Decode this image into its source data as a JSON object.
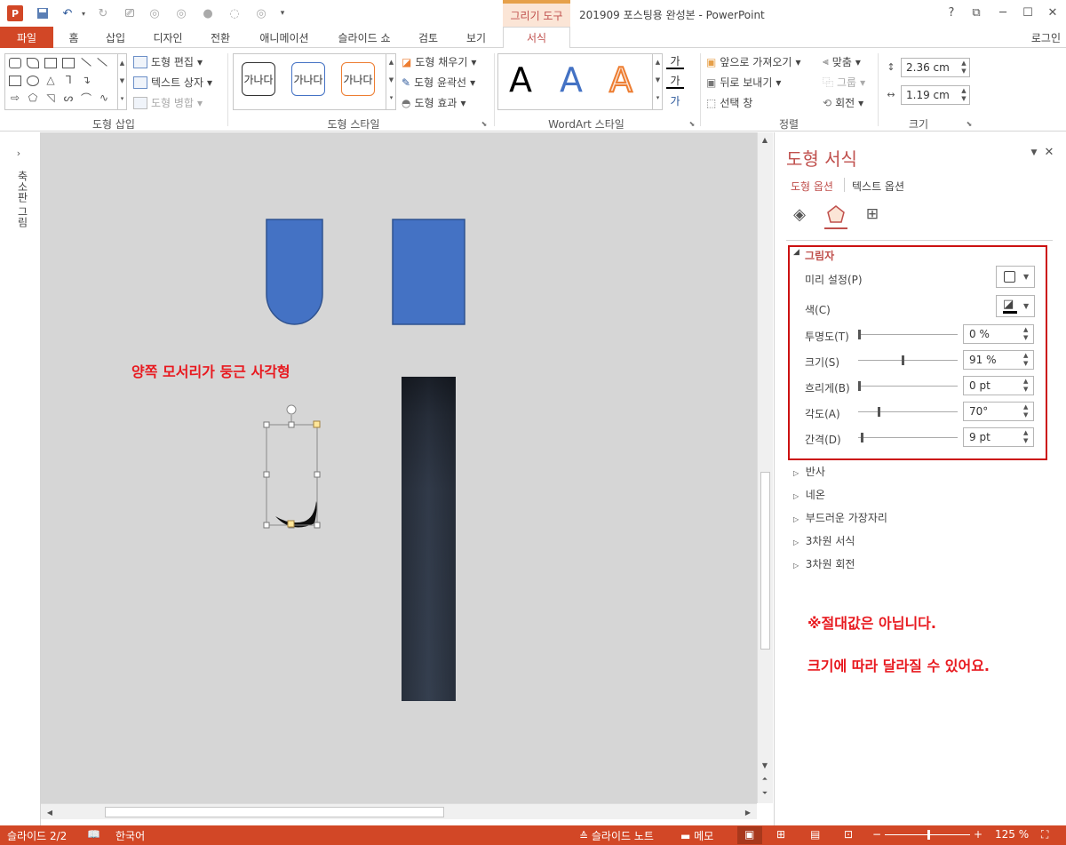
{
  "window": {
    "title": "201909 포스팅용 완성본 - PowerPoint",
    "context_tab_group": "그리기 도구",
    "login": "로그인"
  },
  "tabs": [
    {
      "label": "파일"
    },
    {
      "label": "홈"
    },
    {
      "label": "삽입"
    },
    {
      "label": "디자인"
    },
    {
      "label": "전환"
    },
    {
      "label": "애니메이션"
    },
    {
      "label": "슬라이드 쇼"
    },
    {
      "label": "검토"
    },
    {
      "label": "보기"
    },
    {
      "label": "서식"
    }
  ],
  "ribbon": {
    "insert_shapes": {
      "label": "도형 삽입",
      "edit_shape": "도형 편집",
      "text_box": "텍스트 상자",
      "merge_shapes": "도형 병합"
    },
    "shape_styles": {
      "label": "도형 스타일",
      "style_sample": "가나다",
      "fill": "도형 채우기",
      "outline": "도형 윤곽선",
      "effects": "도형 효과"
    },
    "wordart": {
      "label": "WordArt 스타일",
      "sample": "A"
    },
    "arrange": {
      "label": "정렬",
      "bring_forward": "앞으로 가져오기",
      "send_backward": "뒤로 보내기",
      "selection_pane": "선택 창",
      "align": "맞춤",
      "group": "그룹",
      "rotate": "회전"
    },
    "size": {
      "label": "크기",
      "height": "2.36 cm",
      "width": "1.19 cm"
    }
  },
  "thumb_pane": {
    "label": "축소판 그림"
  },
  "slide": {
    "caption": "양쪽 모서리가 둥근 사각형"
  },
  "format_pane": {
    "title": "도형 서식",
    "tab_shape_options": "도형 옵션",
    "tab_text_options": "텍스트 옵션",
    "shadow": {
      "section": "그림자",
      "preset_label": "미리 설정(P)",
      "color_label": "색(C)",
      "transparency_label": "투명도(T)",
      "transparency_value": "0 %",
      "transparency_level": 0,
      "size_label": "크기(S)",
      "size_value": "91 %",
      "size_level": 0.45,
      "blur_label": "흐리게(B)",
      "blur_value": "0 pt",
      "blur_level": 0,
      "angle_label": "각도(A)",
      "angle_value": "70°",
      "angle_level": 0.2,
      "distance_label": "간격(D)",
      "distance_value": "9 pt",
      "distance_level": 0.03
    },
    "sections": [
      "반사",
      "네온",
      "부드러운 가장자리",
      "3차원 서식",
      "3차원 회전"
    ]
  },
  "notes": {
    "line1": "※절대값은 아닙니다.",
    "line2": "크기에 따라 달라질 수 있어요."
  },
  "status": {
    "slide": "슬라이드 2/2",
    "language": "한국어",
    "notes": "슬라이드 노트",
    "comments": "메모",
    "zoom": "125 %"
  },
  "colors": {
    "accent": "#d24726",
    "shape_blue": "#4472c4",
    "caption_red": "#e8191f"
  }
}
